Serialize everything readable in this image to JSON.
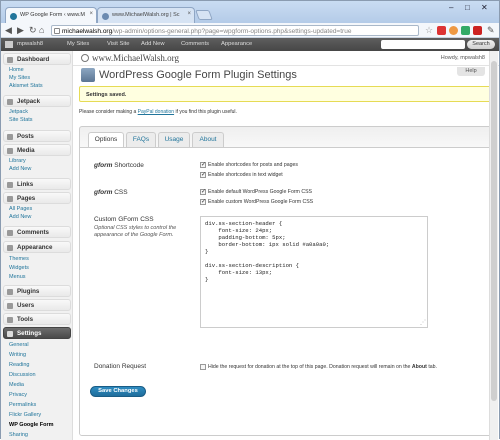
{
  "browser": {
    "tabs": [
      {
        "label": "WP Google Form ‹ www.M"
      },
      {
        "label": "www.MichaelWalsh.org | Sc"
      }
    ],
    "url_host": "michaelwalsh.org",
    "url_path": "/wp-admin/options-general.php?page=wpgform-options.php&settings-updated=true"
  },
  "adminbar": {
    "user": "mpwalsh8",
    "my_sites": "My Sites",
    "visit_site": "Visit Site",
    "add_new": "Add New",
    "comments": "Comments",
    "appearance": "Appearance",
    "search": "Search"
  },
  "sidebar": {
    "dashboard": "Dashboard",
    "dashboard_items": [
      "Home",
      "My Sites",
      "Akismet Stats"
    ],
    "jetpack": "Jetpack",
    "jetpack_items": [
      "Jetpack",
      "Site Stats"
    ],
    "posts": "Posts",
    "media": "Media",
    "media_items": [
      "Library",
      "Add New"
    ],
    "links": "Links",
    "pages": "Pages",
    "pages_items": [
      "All Pages",
      "Add New"
    ],
    "comments": "Comments",
    "appearance": "Appearance",
    "appearance_items": [
      "Themes",
      "Widgets",
      "Menus"
    ],
    "plugins": "Plugins",
    "users": "Users",
    "tools": "Tools",
    "settings": "Settings",
    "settings_items": [
      "General",
      "Writing",
      "Reading",
      "Discussion",
      "Media",
      "Privacy",
      "Permalinks",
      "Flickr Gallery",
      "WP Google Form",
      "Sharing"
    ]
  },
  "main": {
    "site_name": "www.MichaelWalsh.org",
    "howdy": "Howdy, mpwalsh8",
    "help": "Help",
    "page_title": "WordPress Google Form Plugin Settings",
    "notice": "Settings saved.",
    "donate_prefix": "Please consider making a ",
    "donate_link": "PayPal donation",
    "donate_suffix": " if you find this plugin useful.",
    "tabs": [
      "Options",
      "FAQs",
      "Usage",
      "About"
    ],
    "shortcode_label_em": "gform",
    "shortcode_label": " Shortcode",
    "shortcode_opts": [
      "Enable shortcodes for posts and pages",
      "Enable shortcodes in text widget"
    ],
    "css_label_em": "gform",
    "css_label": " CSS",
    "css_opts": [
      "Enable default WordPress Google Form CSS",
      "Enable custom WordPress Google Form CSS"
    ],
    "custom_css_label": "Custom GForm CSS",
    "custom_css_desc": "Optional CSS styles to control the appearance of the Google Form.",
    "custom_css_value": "div.ss-section-header {\n    font-size: 24px;\n    padding-bottom: 5px;\n    border-bottom: 1px solid #a0a0a0;\n}\n\ndiv.ss-section-description {\n    font-size: 13px;\n}",
    "donation_label": "Donation Request",
    "donation_opt_pre": "Hide the request for donation at the top of this page. Donation request will remain on the ",
    "donation_opt_bold": "About",
    "donation_opt_post": " tab.",
    "save": "Save Changes"
  }
}
